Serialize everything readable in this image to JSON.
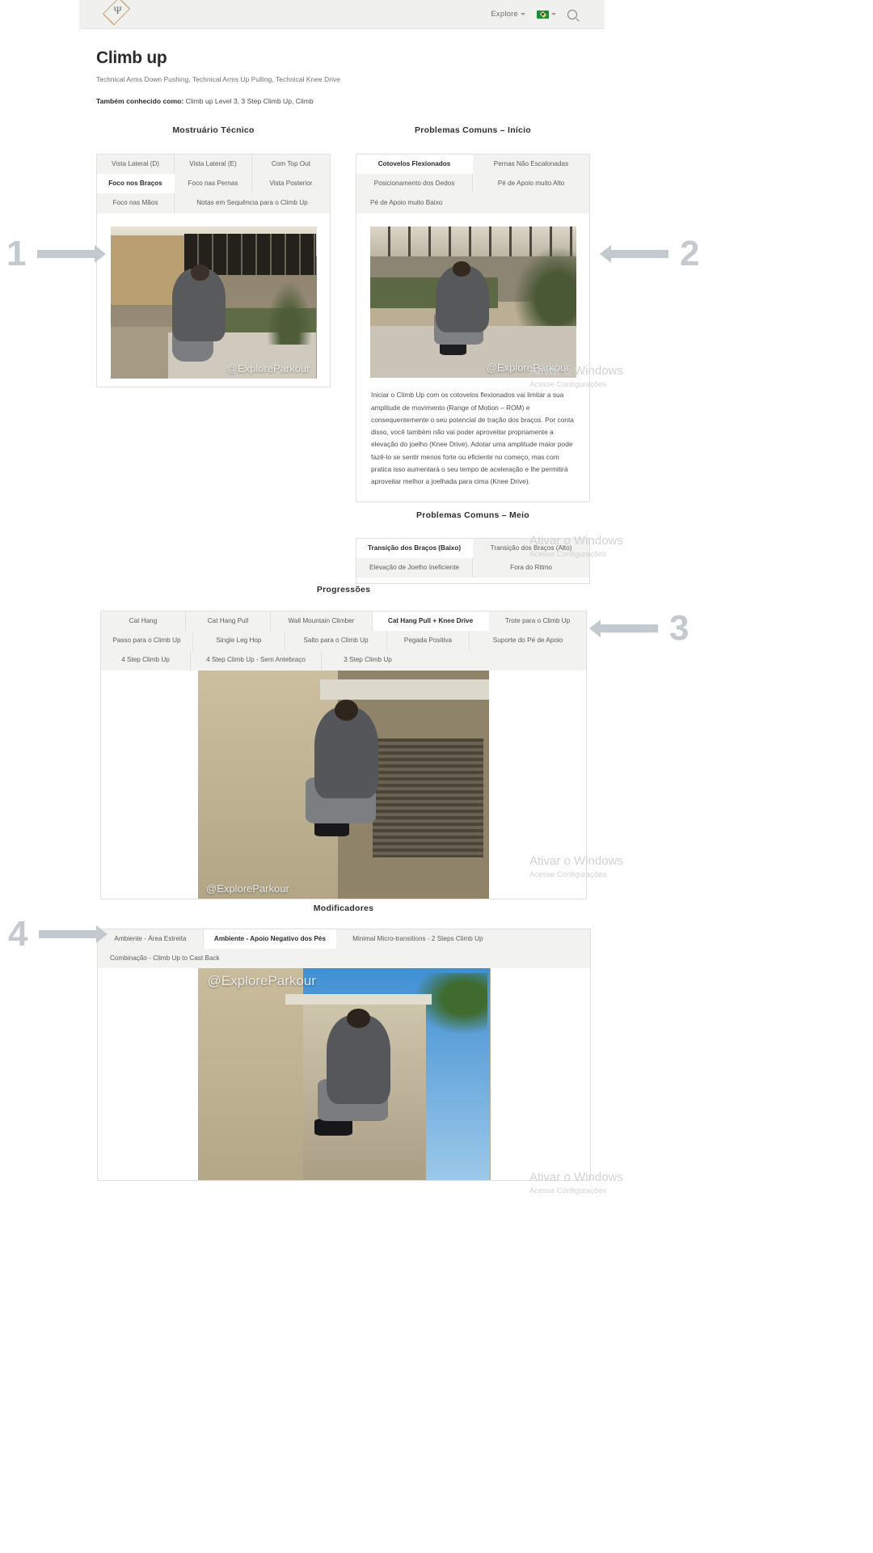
{
  "header": {
    "logo_alt": "Explore Parkour logo",
    "nav": {
      "explore_label": "Explore",
      "language_label": "pt-BR",
      "search_label": "Search"
    }
  },
  "title": {
    "heading": "Climb up",
    "subtitle": "Technical Arms Down Pushing, Technical Arms Up Pulling, Technical Knee Drive",
    "aka_label": "Também conhecido como:",
    "aka_value": " Climb up Level 3, 3 Step Climb Up, Climb"
  },
  "sections": {
    "tecnico": {
      "heading": "Mostruário Técnico",
      "tabs": [
        "Vista Lateral (D)",
        "Vista Lateral (E)",
        "Com Top Out",
        "Foco nos Braços",
        "Foco nas Pernas",
        "Vista Posterior",
        "Foco nas Mãos",
        "Notas em Sequência para o Climb Up"
      ],
      "active_tab": "Foco nos Braços",
      "watermark": "@ExploreParkour"
    },
    "problemas_inicio": {
      "heading": "Problemas Comuns – Início",
      "tabs": [
        "Cotovelos Flexionados",
        "Pernas Não Escalonadas",
        "Posicionamento dos Dedos",
        "Pé de Apoio muito Alto",
        "Pé de Apoio muito Baixo"
      ],
      "active_tab": "Cotovelos Flexionados",
      "watermark": "@ExploreParkour",
      "paragraph": "Iniciar o Climb Up com os cotovelos flexionados vai limitar a sua amplitude de movimento (Range of Motion – ROM) e consequentemente o seu potencial de tração dos braços. Por conta disso, você também não vai poder aproveitar propriamente a elevação do joelho (Knee Drive). Adotar uma amplitude maior pode fazê-lo se sentir menos forte ou eficiente no começo, mas com pratica isso aumentará o seu tempo de aceleração e lhe permitirá aproveitar melhor a joelhada para cima (Knee Drive)."
    },
    "problemas_meio": {
      "heading": "Problemas Comuns – Meio",
      "tabs": [
        "Transição dos Braços (Baixo)",
        "Transição dos Braços (Alto)",
        "Elevação de Joelho Ineficiente",
        "Fora do Ritmo"
      ],
      "active_tab": "Transição dos Braços (Baixo)"
    },
    "progressoes": {
      "heading": "Progressões",
      "tabs": [
        "Cat Hang",
        "Cat Hang Pull",
        "Wall Mountain Climber",
        "Cat Hang Pull + Knee Drive",
        "Trote para o Climb Up",
        "Passo para o Climb Up",
        "Single Leg Hop",
        "Salto para o Climb Up",
        "Pegada Positiva",
        "Suporte do Pé de Apoio",
        "4 Step Climb Up",
        "4 Step Climb Up - Sem Antebraço",
        "3 Step Climb Up"
      ],
      "active_tab": "Cat Hang Pull + Knee Drive",
      "watermark": "@ExploreParkour"
    },
    "modificadores": {
      "heading": "Modificadores",
      "tabs": [
        "Ambiente - Área Estreita",
        "Ambiente - Apoio Negativo dos Pés",
        "Minimal Micro-transitions - 2 Steps Climb Up",
        "Combinação - Climb Up to Cast Back"
      ],
      "active_tab": "Ambiente - Apoio Negativo dos Pés",
      "watermark": "@ExploreParkour"
    }
  },
  "callouts": [
    {
      "number": "1"
    },
    {
      "number": "2"
    },
    {
      "number": "3"
    },
    {
      "number": "4"
    }
  ],
  "activation_watermarks": [
    {
      "line1": "Ativar o Windows",
      "line2": "Acesse Configurações"
    },
    {
      "line1": "Ativar o Windows",
      "line2": "Acesse Configurações"
    },
    {
      "line1": "Ativar o Windows",
      "line2": "Acesse Configurações"
    },
    {
      "line1": "Ativar o Windows",
      "line2": "Acesse Configurações"
    }
  ],
  "colors": {
    "accent": "#c9a87a",
    "tab_bg": "#f2f2f0",
    "callout": "#c2c9cf"
  }
}
